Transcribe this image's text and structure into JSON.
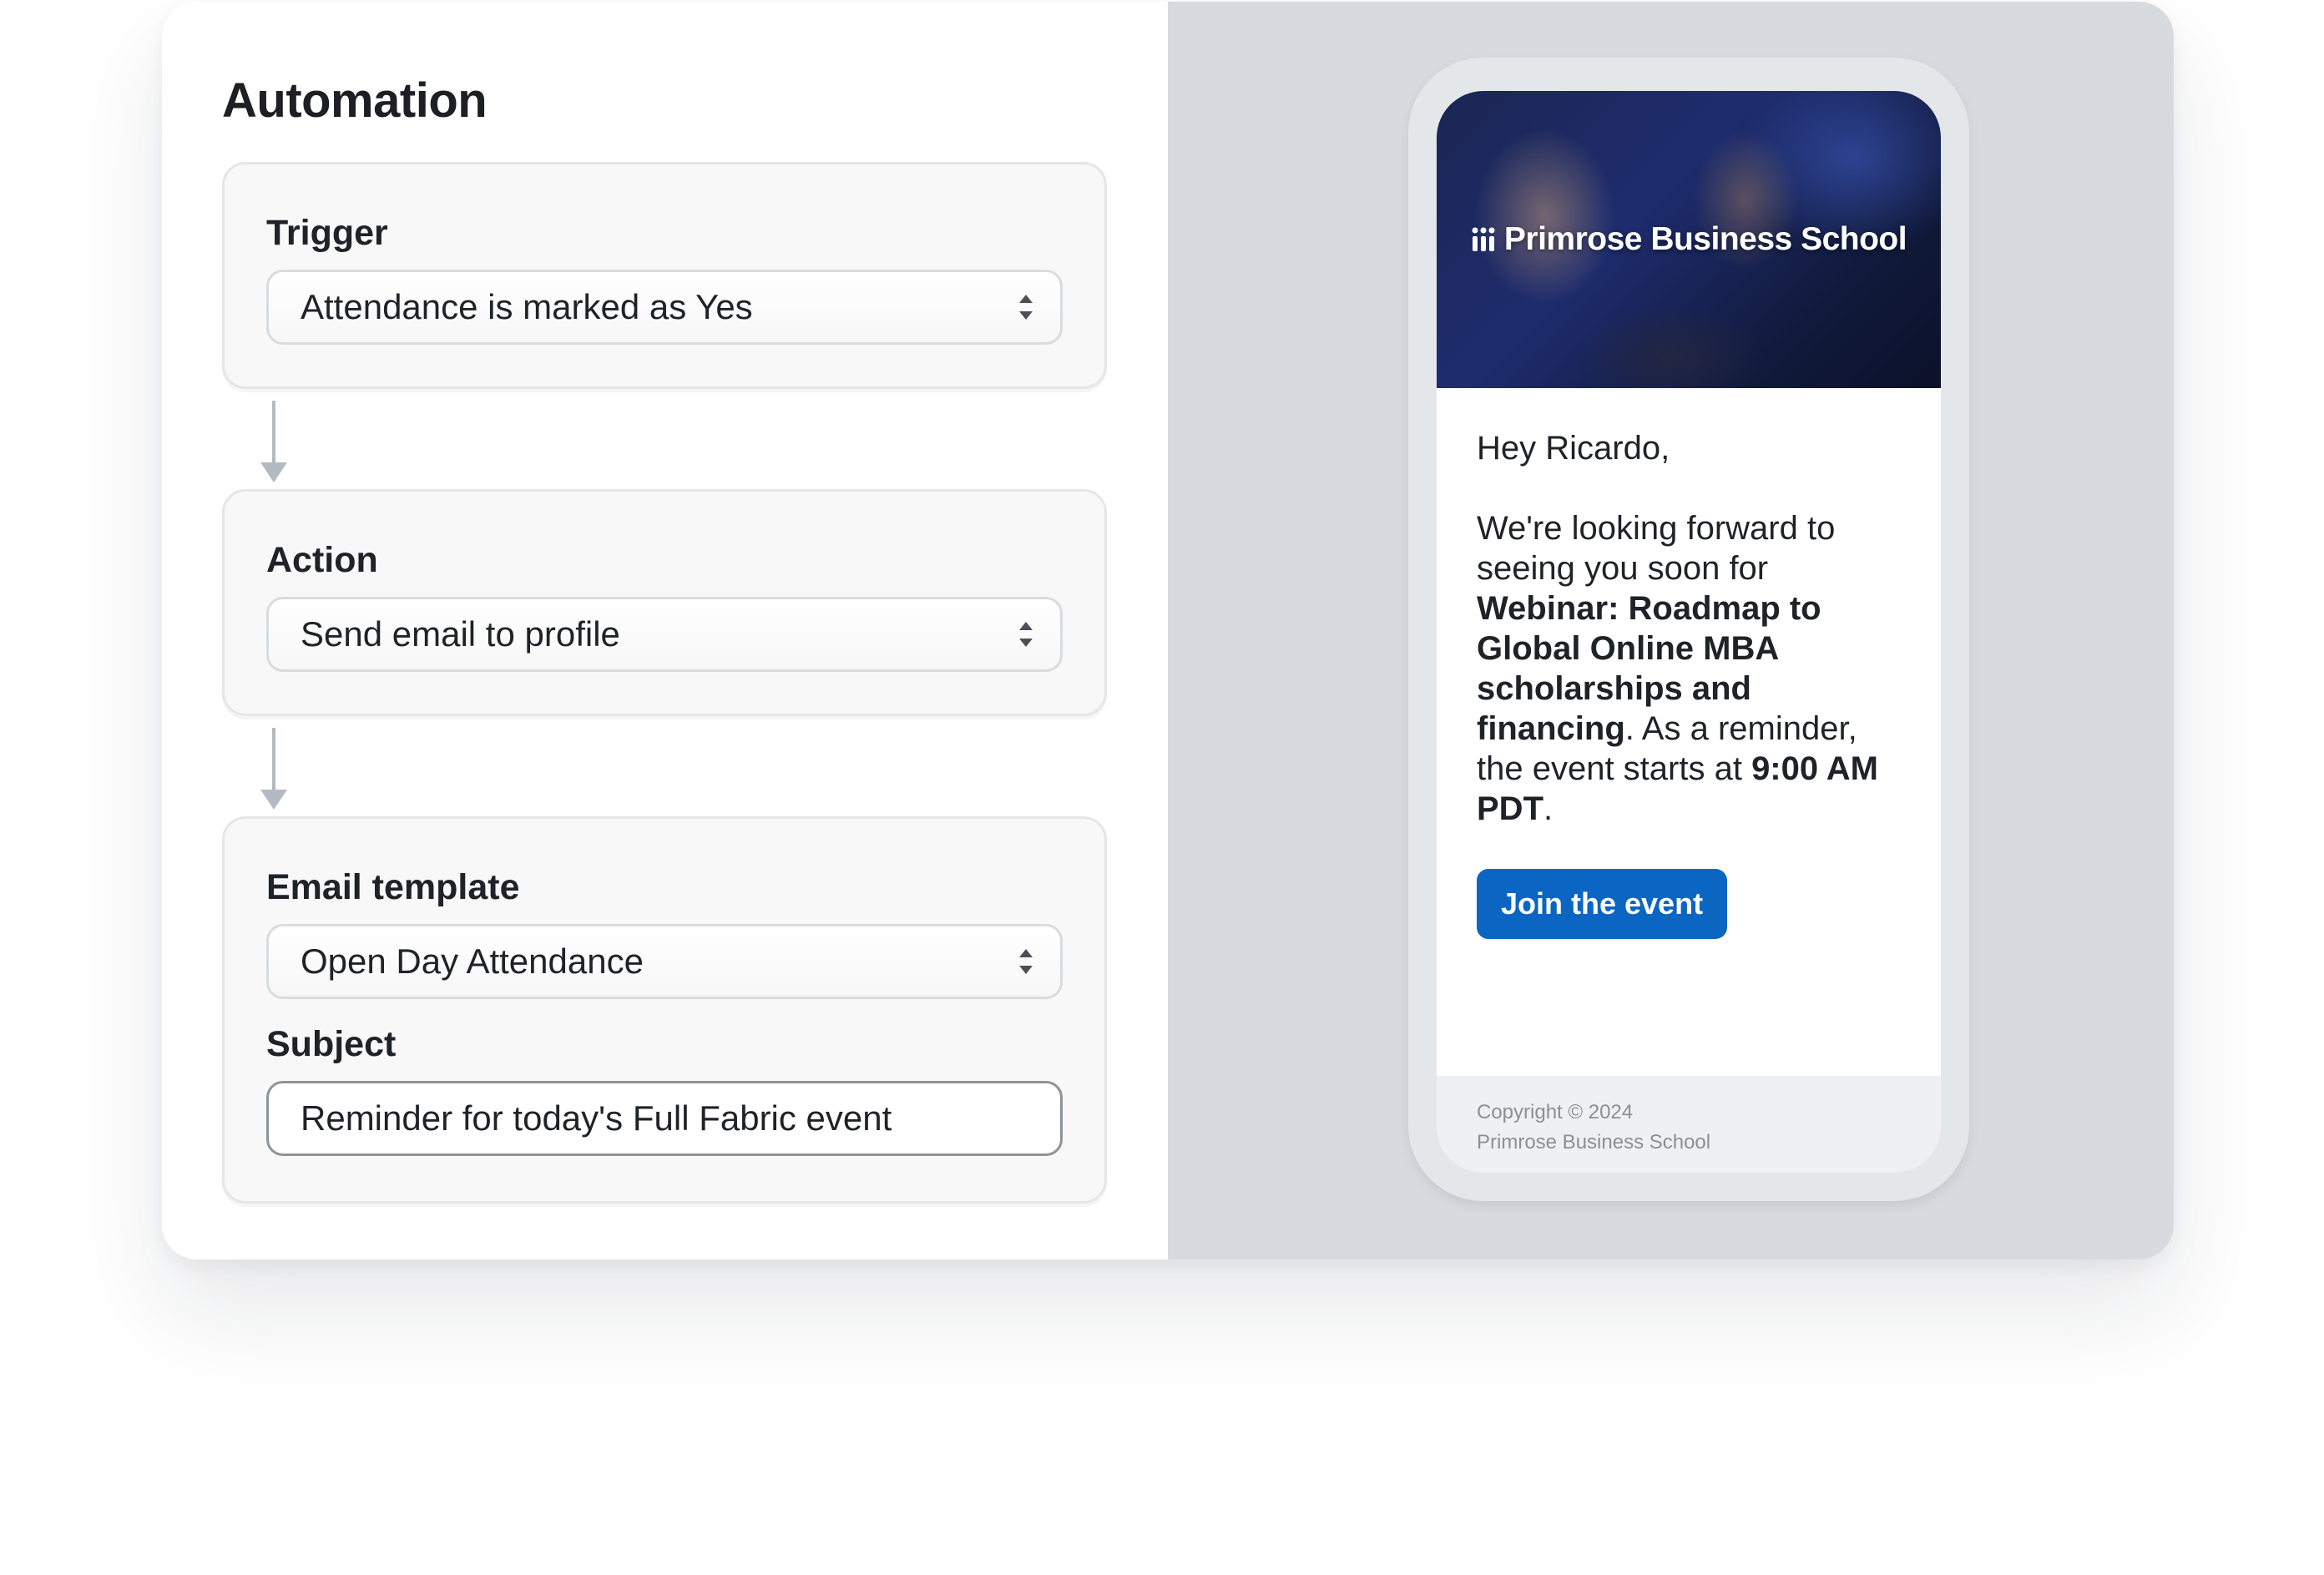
{
  "automation": {
    "title": "Automation",
    "trigger": {
      "label": "Trigger",
      "value": "Attendance is marked as Yes"
    },
    "action": {
      "label": "Action",
      "value": "Send email to profile"
    },
    "email": {
      "template_label": "Email template",
      "template_value": "Open Day Attendance",
      "subject_label": "Subject",
      "subject_value": "Reminder for today's Full Fabric event"
    }
  },
  "preview": {
    "brand": "Primrose Business School",
    "greeting": "Hey Ricardo,",
    "body_intro": "We're looking forward to seeing you soon for ",
    "event_name": "Webinar: Roadmap to Global Online MBA scholarships and financing",
    "body_middle": ". As a reminder, the event starts at ",
    "event_time": "9:00 AM PDT",
    "body_end": ".",
    "cta_label": "Join the event",
    "footer_line1": "Copyright © 2024",
    "footer_line2": "Primrose Business School"
  },
  "colors": {
    "accent": "#0a66c2",
    "preview_background": "#d7dbdf"
  },
  "icons": {
    "select_chevron": "up-down-chevron-icon",
    "connector": "arrow-down-icon",
    "brand_logo": "primrose-logo-icon"
  }
}
